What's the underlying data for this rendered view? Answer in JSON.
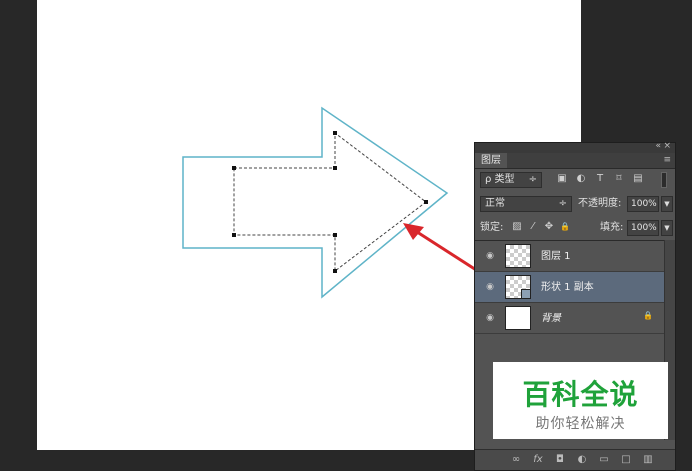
{
  "panel": {
    "tab_label": "图层",
    "collapse_glyph": "«",
    "close_glyph": "×",
    "menu_glyph": "≡",
    "filter": {
      "search_glyph": "ρ",
      "kind_label": "类型",
      "arrow": "÷"
    },
    "filter_icons": [
      "image-filter-icon",
      "adjustment-filter-icon",
      "type-filter-icon",
      "shape-filter-icon",
      "smart-object-filter-icon"
    ],
    "filter_icon_glyphs": {
      "image": "▣",
      "adjust": "◐",
      "type": "T",
      "shape": "⌑",
      "smart": "▤"
    },
    "blend": {
      "mode": "正常",
      "arrow": "÷",
      "opacity_label": "不透明度:",
      "opacity_value": "100%"
    },
    "lock": {
      "label": "锁定:",
      "fill_label": "填充:",
      "fill_value": "100%"
    },
    "lock_glyphs": {
      "pixels": "▨",
      "brush": "⁄",
      "move": "✥",
      "all": "🔒"
    },
    "layers": [
      {
        "name": "图层 1",
        "thumb": "checker",
        "selected": false
      },
      {
        "name": "形状 1 副本",
        "thumb": "checker",
        "selected": true
      },
      {
        "name": "背景",
        "thumb": "white",
        "selected": false,
        "locked": true
      }
    ],
    "eye_glyph": "◉",
    "lock_icon_glyph": "🔒"
  },
  "watermark": {
    "title": "百科全说",
    "subtitle": "助你轻松解决"
  },
  "colors": {
    "shape_stroke": "#5fb4c8",
    "annotation_arrow": "#d9262b",
    "watermark_green": "#1fa23a"
  }
}
